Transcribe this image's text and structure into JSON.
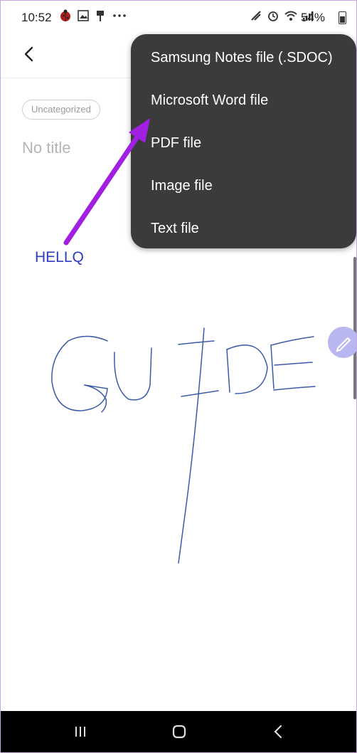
{
  "status_bar": {
    "time": "10:52",
    "battery_percent": "54%",
    "left_icons": [
      "ladybug-icon",
      "image-icon",
      "usb-icon",
      "more-dots-icon"
    ],
    "right_icons": [
      "nfc-icon",
      "alarm-icon",
      "wifi-icon",
      "signal-icon",
      "battery-icon"
    ]
  },
  "note": {
    "category": "Uncategorized",
    "title_placeholder": "No title",
    "annotation": "HELLQ",
    "handwriting_ink_color": "#3a5aa8"
  },
  "export_menu": {
    "items": [
      "Samsung Notes file (.SDOC)",
      "Microsoft Word file",
      "PDF file",
      "Image file",
      "Text file"
    ]
  },
  "colors": {
    "menu_background": "#3b3b3b",
    "arrow": "#a11fe0",
    "annotation_text": "#2b3dc0",
    "pen_button": "#b9b7f0"
  },
  "nav_bar": {
    "buttons": [
      "recent-apps-icon",
      "home-icon",
      "back-icon"
    ]
  }
}
